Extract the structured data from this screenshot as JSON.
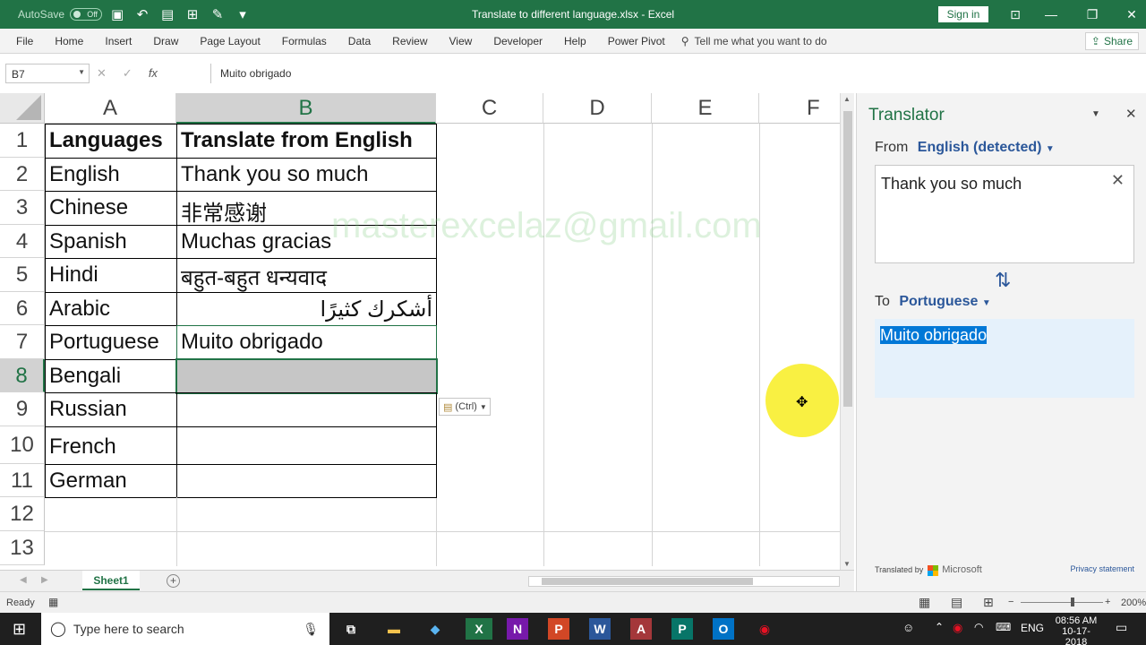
{
  "window": {
    "autosave_label": "AutoSave",
    "autosave_state": "Off",
    "title": "Translate to different language.xlsx  -  Excel",
    "signin": "Sign in"
  },
  "ribbon": {
    "tabs": [
      "File",
      "Home",
      "Insert",
      "Draw",
      "Page Layout",
      "Formulas",
      "Data",
      "Review",
      "View",
      "Developer",
      "Help",
      "Power Pivot"
    ],
    "tellme": "Tell me what you want to do",
    "share": "Share"
  },
  "formula_bar": {
    "name_box": "B7",
    "fx": "fx",
    "content": "Muito obrigado"
  },
  "sheet": {
    "columns": [
      "A",
      "B",
      "C",
      "D",
      "E",
      "F"
    ],
    "rows": [
      "1",
      "2",
      "3",
      "4",
      "5",
      "6",
      "7",
      "8",
      "9",
      "10",
      "11",
      "12",
      "13"
    ],
    "cells": {
      "a1": "Languages",
      "b1": "Translate from English",
      "a2": "English",
      "b2": "Thank you so much",
      "a3": "Chinese",
      "b3": "非常感谢",
      "a4": "Spanish",
      "b4": "Muchas gracias",
      "a5": "Hindi",
      "b5": "बहुत-बहुत धन्यवाद",
      "a6": "Arabic",
      "b6": "أشكرك كثيرًا",
      "a7": "Portuguese",
      "b7": "Muito obrigado",
      "a8": "Bengali",
      "b8": "",
      "a9": "Russian",
      "a10": "French",
      "a11": "German"
    },
    "watermark": "masterexcelaz@gmail.com",
    "paste_options": "(Ctrl)",
    "tab": "Sheet1"
  },
  "status": {
    "ready": "Ready",
    "zoom": "200%"
  },
  "translator": {
    "title": "Translator",
    "from_label": "From",
    "from_lang": "English (detected)",
    "source_text": "Thank you so much",
    "to_label": "To",
    "to_lang": "Portuguese",
    "output_text": "Muito obrigado",
    "translated_by": "Translated by",
    "microsoft": "Microsoft",
    "privacy": "Privacy statement"
  },
  "taskbar": {
    "search_placeholder": "Type here to search",
    "lang": "ENG",
    "time": "08:56 AM",
    "date": "10-17-2018"
  },
  "colors": {
    "excel_green": "#217346",
    "accent_blue": "#2b579a",
    "highlight_yellow": "#f8ee2e"
  }
}
